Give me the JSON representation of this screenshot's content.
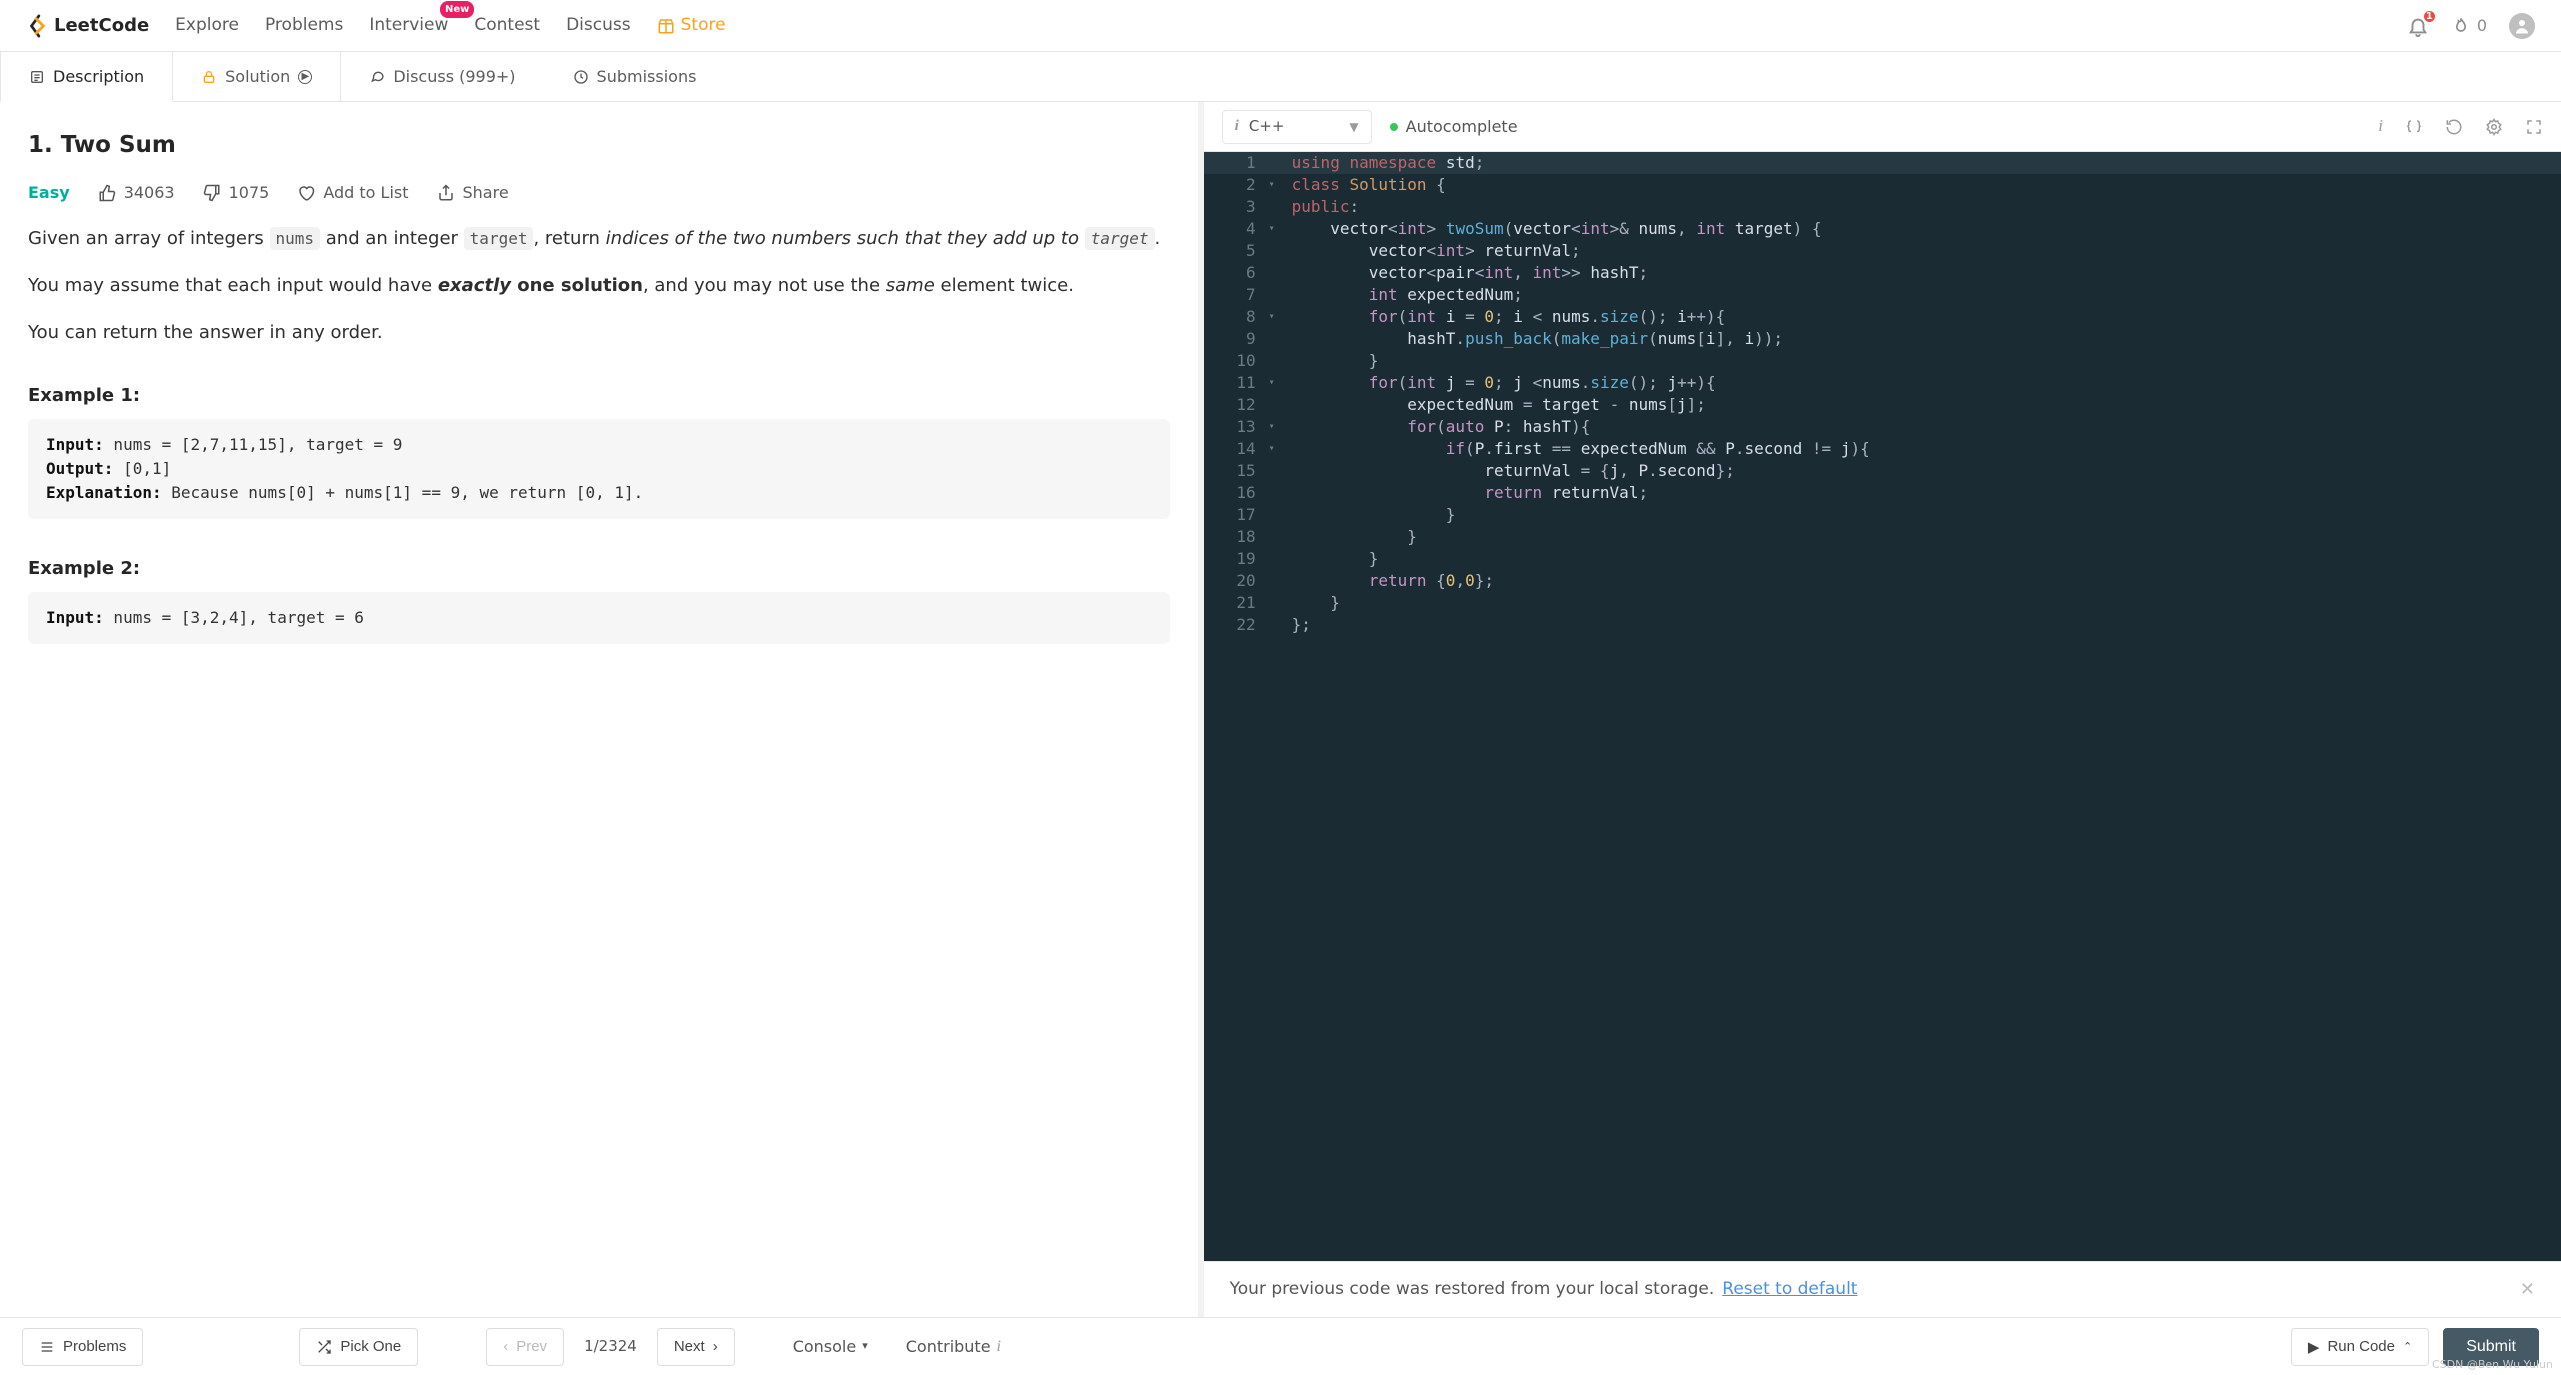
{
  "header": {
    "brand": "LeetCode",
    "nav": [
      "Explore",
      "Problems",
      "Interview",
      "Contest",
      "Discuss",
      "Store"
    ],
    "interview_badge": "New",
    "streak": "0",
    "notifications": "1"
  },
  "tabs": {
    "description": "Description",
    "solution": "Solution",
    "discuss": "Discuss (999+)",
    "submissions": "Submissions"
  },
  "problem": {
    "title": "1. Two Sum",
    "difficulty": "Easy",
    "likes": "34063",
    "dislikes": "1075",
    "add_to_list": "Add to List",
    "share": "Share",
    "para1_a": "Given an array of integers ",
    "code_nums": "nums",
    "para1_b": " and an integer ",
    "code_target": "target",
    "para1_c": ", return ",
    "para1_em": "indices of the two numbers such that they add up to ",
    "para1_d": ".",
    "para2_a": "You may assume that each input would have ",
    "para2_strong": "exactly",
    "para2_b": " one solution",
    "para2_c": ", and you may not use the ",
    "para2_same": "same",
    "para2_d": " element twice.",
    "para3": "You can return the answer in any order.",
    "ex1_head": "Example 1:",
    "ex1_input_l": "Input:",
    "ex1_input_v": " nums = [2,7,11,15], target = 9",
    "ex1_output_l": "Output:",
    "ex1_output_v": " [0,1]",
    "ex1_expl_l": "Explanation:",
    "ex1_expl_v": " Because nums[0] + nums[1] == 9, we return [0, 1].",
    "ex2_head": "Example 2:",
    "ex2_input_l": "Input:",
    "ex2_input_v": " nums = [3,2,4], target = 6"
  },
  "editor": {
    "language": "C++",
    "autocomplete": "Autocomplete"
  },
  "code_lines": [
    {
      "n": "1",
      "fold": "",
      "html": "<span class='tok-kw'>using</span> <span class='tok-kw'>namespace</span> <span class='tok-id'>std</span><span class='tok-pun'>;</span>",
      "hl": true
    },
    {
      "n": "2",
      "fold": "▾",
      "html": "<span class='tok-kw'>class</span> <span class='tok-type'>Solution</span> <span class='tok-pun'>{</span>"
    },
    {
      "n": "3",
      "fold": "",
      "html": "<span class='tok-kw'>public</span><span class='tok-pun'>:</span>"
    },
    {
      "n": "4",
      "fold": "▾",
      "html": "    <span class='tok-id'>vector</span><span class='tok-pun'>&lt;</span><span class='tok-kw2'>int</span><span class='tok-pun'>&gt;</span> <span class='tok-fn'>twoSum</span><span class='tok-pun'>(</span><span class='tok-id'>vector</span><span class='tok-pun'>&lt;</span><span class='tok-kw2'>int</span><span class='tok-pun'>&gt;&amp;</span> <span class='tok-id'>nums</span><span class='tok-pun'>,</span> <span class='tok-kw2'>int</span> <span class='tok-id'>target</span><span class='tok-pun'>) {</span>"
    },
    {
      "n": "5",
      "fold": "",
      "html": "        <span class='tok-id'>vector</span><span class='tok-pun'>&lt;</span><span class='tok-kw2'>int</span><span class='tok-pun'>&gt;</span> <span class='tok-id'>returnVal</span><span class='tok-pun'>;</span>"
    },
    {
      "n": "6",
      "fold": "",
      "html": "        <span class='tok-id'>vector</span><span class='tok-pun'>&lt;</span><span class='tok-id'>pair</span><span class='tok-pun'>&lt;</span><span class='tok-kw2'>int</span><span class='tok-pun'>,</span> <span class='tok-kw2'>int</span><span class='tok-pun'>&gt;&gt;</span> <span class='tok-id'>hashT</span><span class='tok-pun'>;</span>"
    },
    {
      "n": "7",
      "fold": "",
      "html": "        <span class='tok-kw2'>int</span> <span class='tok-id'>expectedNum</span><span class='tok-pun'>;</span>"
    },
    {
      "n": "8",
      "fold": "▾",
      "html": "        <span class='tok-kw2'>for</span><span class='tok-pun'>(</span><span class='tok-kw2'>int</span> <span class='tok-id'>i</span> <span class='tok-pun'>=</span> <span class='tok-num'>0</span><span class='tok-pun'>;</span> <span class='tok-id'>i</span> <span class='tok-pun'>&lt;</span> <span class='tok-id'>nums</span><span class='tok-pun'>.</span><span class='tok-fn'>size</span><span class='tok-pun'>();</span> <span class='tok-id'>i</span><span class='tok-pun'>++){</span>"
    },
    {
      "n": "9",
      "fold": "",
      "html": "            <span class='tok-id'>hashT</span><span class='tok-pun'>.</span><span class='tok-fn'>push_back</span><span class='tok-pun'>(</span><span class='tok-fn'>make_pair</span><span class='tok-pun'>(</span><span class='tok-id'>nums</span><span class='tok-pun'>[</span><span class='tok-id'>i</span><span class='tok-pun'>],</span> <span class='tok-id'>i</span><span class='tok-pun'>));</span>"
    },
    {
      "n": "10",
      "fold": "",
      "html": "        <span class='tok-pun'>}</span>"
    },
    {
      "n": "11",
      "fold": "▾",
      "html": "        <span class='tok-kw2'>for</span><span class='tok-pun'>(</span><span class='tok-kw2'>int</span> <span class='tok-id'>j</span> <span class='tok-pun'>=</span> <span class='tok-num'>0</span><span class='tok-pun'>;</span> <span class='tok-id'>j</span> <span class='tok-pun'>&lt;</span><span class='tok-id'>nums</span><span class='tok-pun'>.</span><span class='tok-fn'>size</span><span class='tok-pun'>();</span> <span class='tok-id'>j</span><span class='tok-pun'>++){</span>"
    },
    {
      "n": "12",
      "fold": "",
      "html": "            <span class='tok-id'>expectedNum</span> <span class='tok-pun'>=</span> <span class='tok-id'>target</span> <span class='tok-pun'>-</span> <span class='tok-id'>nums</span><span class='tok-pun'>[</span><span class='tok-id'>j</span><span class='tok-pun'>];</span>"
    },
    {
      "n": "13",
      "fold": "▾",
      "html": "            <span class='tok-kw2'>for</span><span class='tok-pun'>(</span><span class='tok-kw2'>auto</span> <span class='tok-id'>P</span><span class='tok-pun'>:</span> <span class='tok-id'>hashT</span><span class='tok-pun'>){</span>"
    },
    {
      "n": "14",
      "fold": "▾",
      "html": "                <span class='tok-kw2'>if</span><span class='tok-pun'>(</span><span class='tok-id'>P</span><span class='tok-pun'>.</span><span class='tok-id'>first</span> <span class='tok-pun'>==</span> <span class='tok-id'>expectedNum</span> <span class='tok-pun'>&amp;&amp;</span> <span class='tok-id'>P</span><span class='tok-pun'>.</span><span class='tok-id'>second</span> <span class='tok-pun'>!=</span> <span class='tok-id'>j</span><span class='tok-pun'>){</span>"
    },
    {
      "n": "15",
      "fold": "",
      "html": "                    <span class='tok-id'>returnVal</span> <span class='tok-pun'>= {</span><span class='tok-id'>j</span><span class='tok-pun'>,</span> <span class='tok-id'>P</span><span class='tok-pun'>.</span><span class='tok-id'>second</span><span class='tok-pun'>};</span>"
    },
    {
      "n": "16",
      "fold": "",
      "html": "                    <span class='tok-kw2'>return</span> <span class='tok-id'>returnVal</span><span class='tok-pun'>;</span>"
    },
    {
      "n": "17",
      "fold": "",
      "html": "                <span class='tok-pun'>}</span>"
    },
    {
      "n": "18",
      "fold": "",
      "html": "            <span class='tok-pun'>}</span>"
    },
    {
      "n": "19",
      "fold": "",
      "html": "        <span class='tok-pun'>}</span>"
    },
    {
      "n": "20",
      "fold": "",
      "html": "        <span class='tok-kw2'>return</span> <span class='tok-pun'>{</span><span class='tok-num'>0</span><span class='tok-pun'>,</span><span class='tok-num'>0</span><span class='tok-pun'>};</span>"
    },
    {
      "n": "21",
      "fold": "",
      "html": "    <span class='tok-pun'>}</span>"
    },
    {
      "n": "22",
      "fold": "",
      "html": "<span class='tok-pun'>};</span>"
    }
  ],
  "restore": {
    "msg": "Your previous code was restored from your local storage.  ",
    "link": "Reset to default"
  },
  "footer": {
    "problems": "Problems",
    "pick_one": "Pick One",
    "prev": "Prev",
    "page": "1/2324",
    "next": "Next",
    "console": "Console",
    "contribute": "Contribute",
    "run_code": "Run Code",
    "submit": "Submit"
  },
  "watermark": "CSDN @Ben Wu Yulun"
}
